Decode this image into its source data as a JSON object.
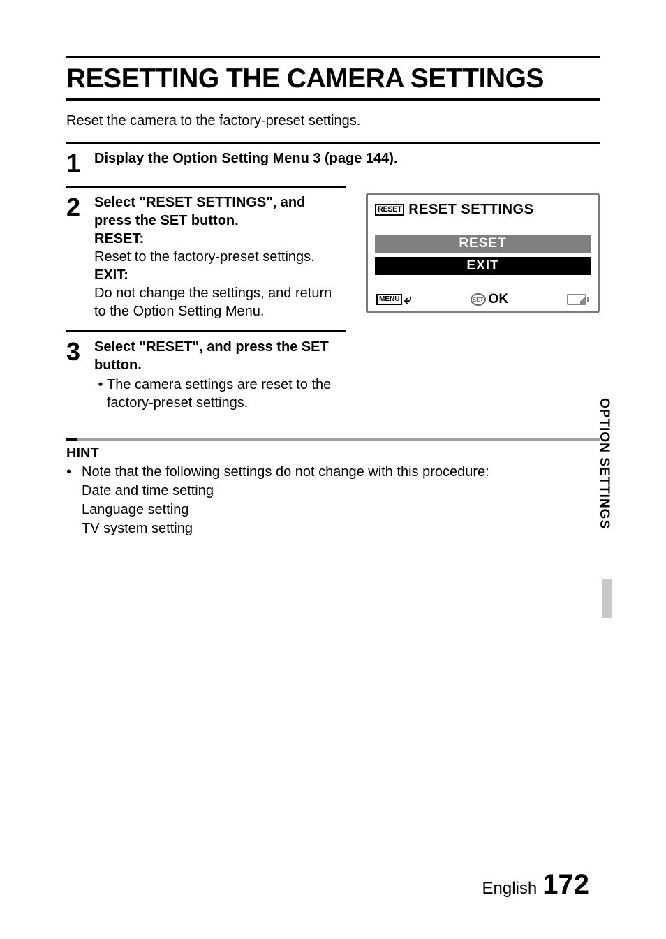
{
  "title": "RESETTING THE CAMERA SETTINGS",
  "intro": "Reset the camera to the factory-preset settings.",
  "steps": {
    "s1": {
      "num": "1",
      "heading": "Display the Option Setting Menu 3 (page 144)."
    },
    "s2": {
      "num": "2",
      "heading": "Select \"RESET SETTINGS\", and press the SET button.",
      "reset_label": "RESET:",
      "reset_text": "Reset to the factory-preset settings.",
      "exit_label": "EXIT:",
      "exit_text": "Do not change the settings, and return to the Option Setting Menu."
    },
    "s3": {
      "num": "3",
      "heading": "Select \"RESET\", and press the SET button.",
      "bullet": "The camera settings are reset to the factory-preset settings."
    }
  },
  "screen": {
    "chip": "RESET",
    "title": "RESET SETTINGS",
    "reset_btn": "RESET",
    "exit_btn": "EXIT",
    "menu_chip": "MENU",
    "set_chip": "SET",
    "ok": "OK"
  },
  "hint": {
    "label": "HINT",
    "line1": "Note that the following settings do not change with this procedure:",
    "sub1": "Date and time setting",
    "sub2": "Language setting",
    "sub3": "TV system setting"
  },
  "side_tab": "OPTION SETTINGS",
  "footer": {
    "lang": "English",
    "page": "172"
  }
}
